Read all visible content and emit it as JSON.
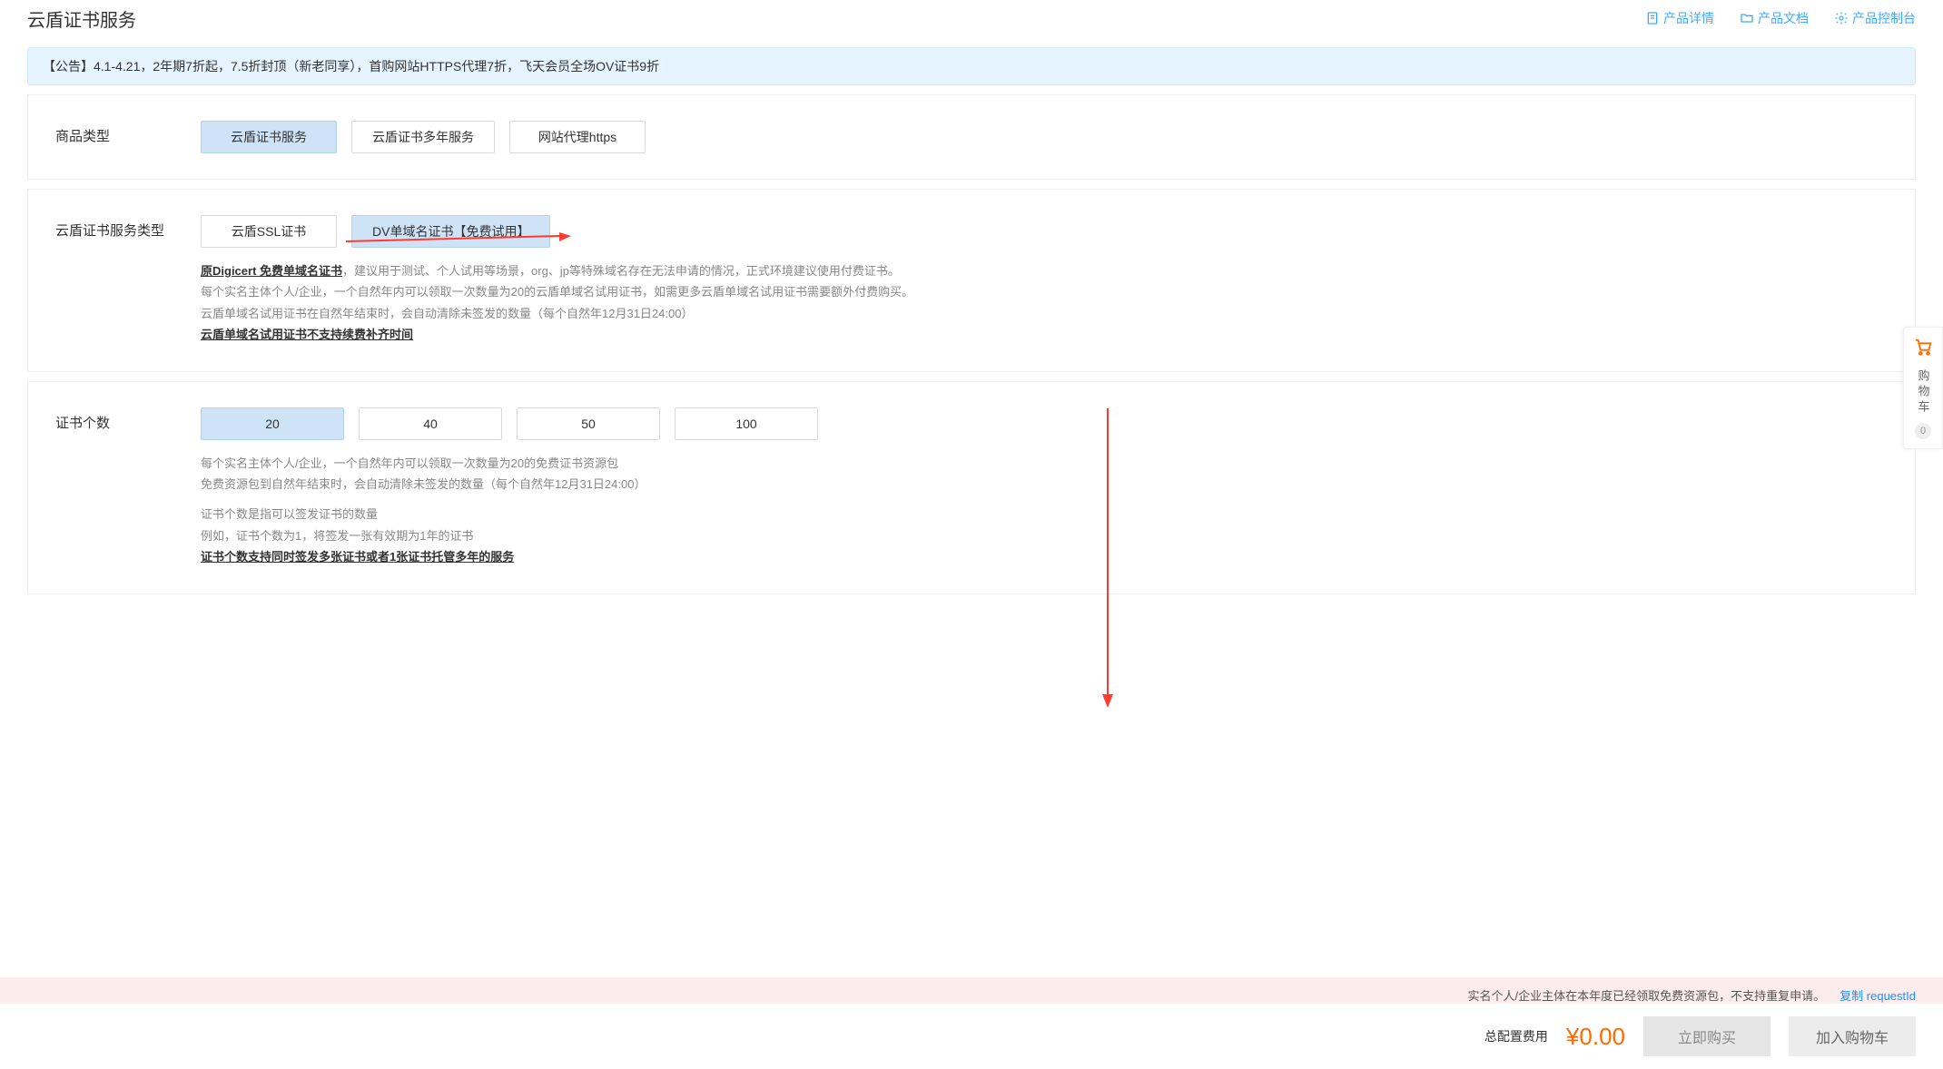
{
  "header": {
    "title": "云盾证书服务",
    "links": {
      "detail": "产品详情",
      "docs": "产品文档",
      "console": "产品控制台"
    }
  },
  "notice": "【公告】4.1-4.21，2年期7折起，7.5折封顶（新老同享），首购网站HTTPS代理7折，飞天会员全场OV证书9折",
  "product_type": {
    "label": "商品类型",
    "options": [
      "云盾证书服务",
      "云盾证书多年服务",
      "网站代理https"
    ]
  },
  "service_type": {
    "label": "云盾证书服务类型",
    "options": [
      "云盾SSL证书",
      "DV单域名证书【免费试用】"
    ],
    "desc_bold1": "原Digicert 免费单域名证书",
    "desc_line1_rest": "，建议用于测试、个人试用等场景，org、jp等特殊域名存在无法申请的情况，正式环境建议使用付费证书。",
    "desc_line2": "每个实名主体个人/企业，一个自然年内可以领取一次数量为20的云盾单域名试用证书，如需更多云盾单域名试用证书需要额外付费购买。",
    "desc_line3": "云盾单域名试用证书在自然年结束时，会自动清除未签发的数量（每个自然年12月31日24:00）",
    "desc_bold2": "云盾单域名试用证书不支持续费补齐时间"
  },
  "cert_count": {
    "label": "证书个数",
    "options": [
      "20",
      "40",
      "50",
      "100"
    ],
    "desc_line1": "每个实名主体个人/企业，一个自然年内可以领取一次数量为20的免费证书资源包",
    "desc_line2": "免费资源包到自然年结束时，会自动清除未签发的数量（每个自然年12月31日24:00）",
    "desc_line3": "证书个数是指可以签发证书的数量",
    "desc_line4": "例如，证书个数为1，将签发一张有效期为1年的证书",
    "desc_bold": "证书个数支持同时签发多张证书或者1张证书托管多年的服务"
  },
  "cart": {
    "label": "购物车",
    "badge": "0"
  },
  "error": {
    "message": "实名个人/企业主体在本年度已经领取免费资源包，不支持重复申请。",
    "copy": "复制 requestId"
  },
  "footer": {
    "total_label": "总配置费用",
    "price": "¥0.00",
    "buy_now": "立即购买",
    "add_cart": "加入购物车"
  }
}
